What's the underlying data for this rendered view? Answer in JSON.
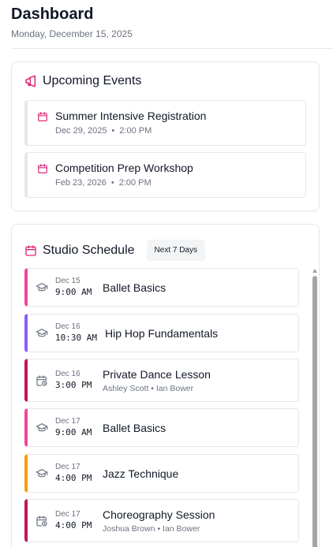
{
  "header": {
    "title": "Dashboard",
    "date": "Monday, December 15, 2025"
  },
  "upcoming_events": {
    "title": "Upcoming Events",
    "icon": "megaphone-icon",
    "accent": "#db2777",
    "items": [
      {
        "title": "Summer Intensive Registration",
        "date": "Dec 29, 2025",
        "separator": "•",
        "time": "2:00 PM"
      },
      {
        "title": "Competition Prep Workshop",
        "date": "Feb 23, 2026",
        "separator": "•",
        "time": "2:00 PM"
      }
    ]
  },
  "studio_schedule": {
    "title": "Studio Schedule",
    "badge": "Next 7 Days",
    "icon": "calendar-icon",
    "items": [
      {
        "date": "Dec 15",
        "time": "9:00 AM",
        "title": "Ballet Basics",
        "people": "",
        "icon": "graduation-cap-icon",
        "color": "#ec4899"
      },
      {
        "date": "Dec 16",
        "time": "10:30 AM",
        "title": "Hip Hop Fundamentals",
        "people": "",
        "icon": "graduation-cap-icon",
        "color": "#8b5cf6"
      },
      {
        "date": "Dec 16",
        "time": "3:00 PM",
        "title": "Private Dance Lesson",
        "people": "Ashley Scott • Ian Bower",
        "icon": "calendar-clock-icon",
        "color": "#be185d"
      },
      {
        "date": "Dec 17",
        "time": "9:00 AM",
        "title": "Ballet Basics",
        "people": "",
        "icon": "graduation-cap-icon",
        "color": "#ec4899"
      },
      {
        "date": "Dec 17",
        "time": "4:00 PM",
        "title": "Jazz Technique",
        "people": "",
        "icon": "graduation-cap-icon",
        "color": "#f59e0b"
      },
      {
        "date": "Dec 17",
        "time": "4:00 PM",
        "title": "Choreography Session",
        "people": "Joshua Brown • Ian Bower",
        "icon": "calendar-clock-icon",
        "color": "#be185d"
      }
    ]
  }
}
